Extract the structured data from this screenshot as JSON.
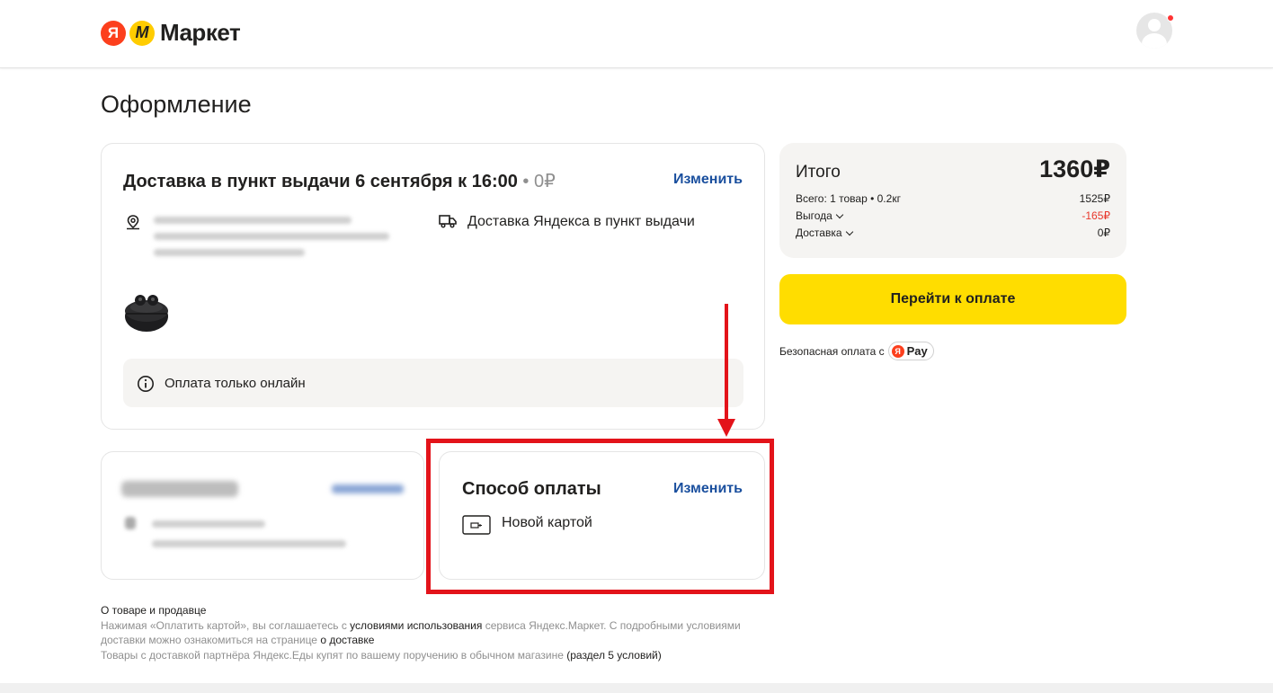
{
  "header": {
    "logo_ya": "Я",
    "logo_m": "М",
    "logo_text": "Маркет"
  },
  "page_title": "Оформление",
  "delivery": {
    "title": "Доставка в пункт выдачи 6 сентября к 16:00",
    "separator": " • ",
    "price": "0₽",
    "change_label": "Изменить",
    "method": "Доставка Яндекса в пункт выдачи",
    "info_text": "Оплата только онлайн"
  },
  "payment": {
    "title": "Способ оплаты",
    "change_label": "Изменить",
    "method": "Новой картой"
  },
  "summary": {
    "title": "Итого",
    "total": "1360₽",
    "rows": [
      {
        "label": "Всего: 1 товар • 0.2кг",
        "value": "1525₽"
      },
      {
        "label": "Выгода",
        "value": "-165₽"
      },
      {
        "label": "Доставка",
        "value": "0₽"
      }
    ],
    "pay_button": "Перейти к оплате",
    "secure_text": "Безопасная оплата с",
    "pay_badge_ya": "Я",
    "pay_badge": "Pay"
  },
  "footer": {
    "line1": "О товаре и продавце",
    "line2a": "Нажимая «Оплатить картой», вы соглашаетесь с ",
    "line2b": "условиями использования",
    "line2c": " сервиса Яндекс.Маркет. С подробными условиями",
    "line3a": "доставки можно ознакомиться на странице ",
    "line3b": "о доставке",
    "line4a": "Товары с доставкой партнёра Яндекс.Еды купят по вашему поручению в обычном магазине ",
    "line4b": "(раздел 5 условий)"
  },
  "colors": {
    "accent_yellow": "#ffdd00",
    "link_blue": "#1a4f9e",
    "highlight_red": "#e3131a",
    "discount_red": "#e8372b"
  }
}
